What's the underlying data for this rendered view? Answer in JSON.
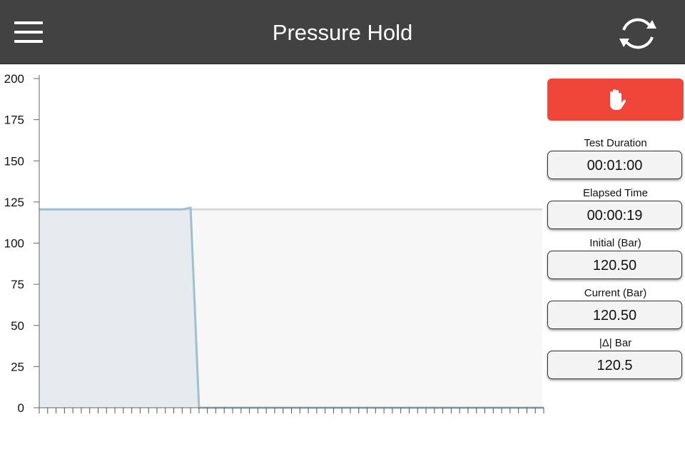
{
  "header": {
    "title": "Pressure Hold",
    "menu_icon": "hamburger-menu-icon",
    "refresh_icon": "refresh-icon"
  },
  "stop_button": {
    "icon": "hand-stop-icon",
    "color": "#f0463a"
  },
  "readouts": [
    {
      "label": "Test Duration",
      "value": "00:01:00"
    },
    {
      "label": "Elapsed Time",
      "value": "00:00:19"
    },
    {
      "label": "Initial (Bar)",
      "value": "120.50"
    },
    {
      "label": "Current (Bar)",
      "value": "120.50"
    },
    {
      "label": "|Δ| Bar",
      "value": "120.5"
    }
  ],
  "chart_data": {
    "type": "area",
    "ylim": [
      0,
      200
    ],
    "yticks": [
      "0",
      "25",
      "50",
      "75",
      "100",
      "125",
      "150",
      "175",
      "200"
    ],
    "xlim": [
      0,
      60
    ],
    "x_tick_count": 61,
    "x_tick_labels_shown": false,
    "reference_line": {
      "value": 120.5,
      "color": "#d8d8d8"
    },
    "series": [
      {
        "x": [
          0,
          1,
          2,
          3,
          4,
          5,
          6,
          7,
          8,
          9,
          10,
          11,
          12,
          13,
          14,
          15,
          16,
          17,
          18,
          19,
          20,
          25,
          30,
          35,
          40,
          45,
          50,
          55,
          60
        ],
        "values": [
          120.5,
          120.5,
          120.5,
          120.5,
          120.5,
          120.5,
          120.5,
          120.5,
          120.5,
          120.5,
          120.5,
          120.5,
          120.5,
          120.5,
          120.5,
          120.5,
          120.5,
          120.5,
          121.5,
          0,
          0,
          0,
          0,
          0,
          0,
          0,
          0,
          0,
          0
        ],
        "color": "#9fc0cf",
        "fill": "#e6ebf0"
      }
    ],
    "plot_background": "#f7f7f7",
    "grid": false
  }
}
